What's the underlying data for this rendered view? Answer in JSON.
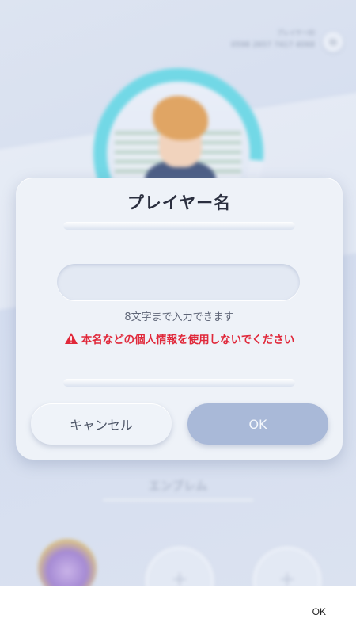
{
  "background": {
    "player_id_label": "プレイヤーID",
    "player_id_value": "0598 2657 7417 4068",
    "emblem_label": "エンブレム",
    "copy_icon": "copy-icon"
  },
  "dialog": {
    "title": "プレイヤー名",
    "input_value": "",
    "hint": "8文字まで入力できます",
    "warning": "本名などの個人情報を使用しないでください",
    "warning_icon": "warning-triangle-icon",
    "warning_color": "#e0283a",
    "cancel_label": "キャンセル",
    "ok_label": "OK"
  },
  "bottom_bar": {
    "ok_label": "OK"
  }
}
